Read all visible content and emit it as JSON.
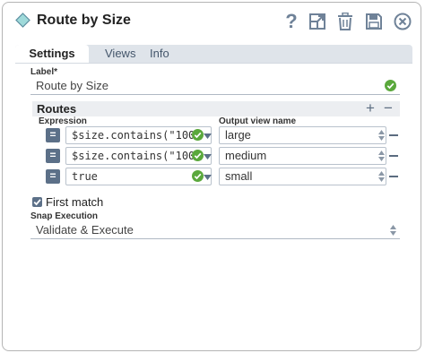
{
  "header": {
    "title": "Route by Size",
    "icons": [
      "snap-diamond-icon",
      "help-icon",
      "expand-icon",
      "trash-icon",
      "save-icon",
      "close-icon"
    ],
    "help_label": "?"
  },
  "tabs": [
    {
      "label": "Settings",
      "active": true
    },
    {
      "label": "Views",
      "active": false
    },
    {
      "label": "Info",
      "active": false
    }
  ],
  "settings": {
    "label_field": {
      "label": "Label*",
      "value": "Route by Size"
    },
    "routes": {
      "title": "Routes",
      "add_label": "+",
      "remove_label": "−",
      "col_expression": "Expression",
      "col_output": "Output view name",
      "eq_label": "=",
      "rows": [
        {
          "expression": "$size.contains(\"100",
          "output": "large"
        },
        {
          "expression": "$size.contains(\"100",
          "output": "medium"
        },
        {
          "expression": "true",
          "output": "small"
        }
      ]
    },
    "first_match": {
      "label": "First match",
      "checked": true
    },
    "snap_execution": {
      "label": "Snap Execution",
      "value": "Validate & Execute"
    }
  },
  "colors": {
    "accent": "#5c7088",
    "valid_green": "#5aa83c",
    "tab_bar": "#dfe4ea",
    "diamond": "#7ac6c6"
  }
}
